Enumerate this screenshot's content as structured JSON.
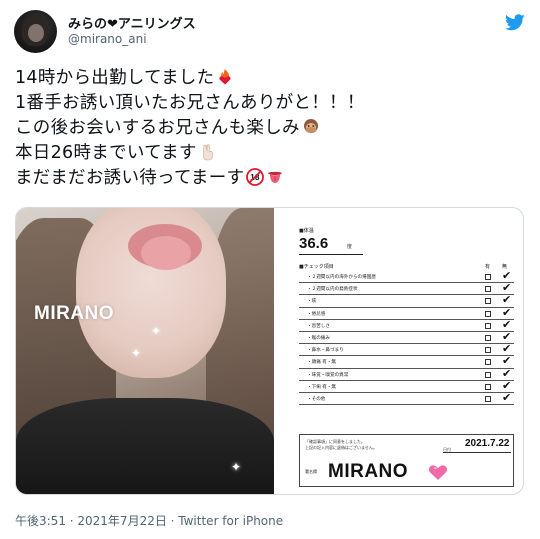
{
  "user": {
    "display_name": "みらの❤アニリングス",
    "handle": "@mirano_ani"
  },
  "tweet": {
    "lines": [
      "14時から出勤してました",
      "1番手お誘い頂いたお兄さんありがと！！！",
      "この後お会いするお兄さんも楽しみ",
      "本日26時までいてます",
      "まだまだお誘い待ってまーす"
    ],
    "emoji_icons": [
      "fire-heart-icon",
      "speak-no-evil-monkey-icon",
      "victory-hand-icon",
      "no-under-18-icon",
      "tongue-icon"
    ]
  },
  "photo": {
    "name": "MIRANO"
  },
  "card": {
    "temp_label": "■体温",
    "temp_value": "36.6",
    "temp_unit": "度",
    "check_header": "■チェック項目",
    "col_yes": "有",
    "col_no": "無",
    "items": [
      {
        "label": "・２週間以内の海外からの帰国歴",
        "checked_no": true
      },
      {
        "label": "・２週間以内の発熱症状",
        "checked_no": true
      },
      {
        "label": "・咳",
        "checked_no": true
      },
      {
        "label": "・倦怠感",
        "checked_no": true
      },
      {
        "label": "・息苦しさ",
        "checked_no": true
      },
      {
        "label": "・喉の痛み",
        "checked_no": true
      },
      {
        "label": "・鼻水・鼻づまり",
        "checked_no": true
      },
      {
        "label": "・頭痛 有・無",
        "checked_no": true
      },
      {
        "label": "・味覚・嗅覚の異常",
        "checked_no": true
      },
      {
        "label": "・下痢 有・無",
        "checked_no": true
      },
      {
        "label": "・その他",
        "checked_no": true
      }
    ],
    "notice_line1": "「確認事項」に同意をしました。",
    "notice_line2": "上記の記入内容に虚偽はございません。",
    "date_label": "日付",
    "date_value": "2021.7.22",
    "staff_label": "署名欄",
    "staff_name": "MIRANO"
  },
  "meta": {
    "timestamp": "午後3:51 · 2021年7月22日 · Twitter for iPhone"
  },
  "colors": {
    "twitter_blue": "#1d9bf0",
    "text": "#0f1419",
    "muted": "#536471",
    "heart_pink": "#f06aa8"
  }
}
